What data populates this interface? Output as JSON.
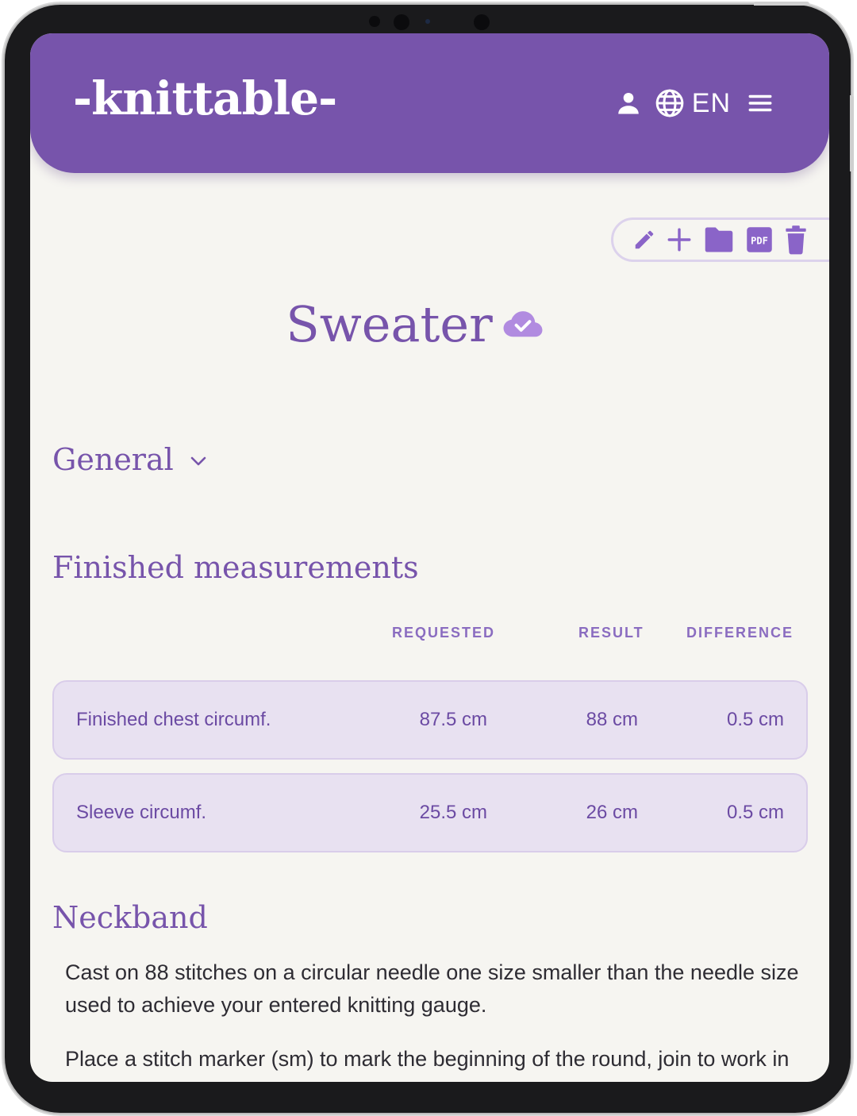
{
  "app": {
    "logo_text": "-knittable-",
    "language_code": "EN"
  },
  "page": {
    "title": "Sweater"
  },
  "sections": {
    "general": "General",
    "finished_measurements": "Finished measurements",
    "neckband": "Neckband"
  },
  "table": {
    "headers": [
      "REQUESTED",
      "RESULT",
      "DIFFERENCE"
    ],
    "rows": [
      {
        "name": "Finished chest circumf.",
        "requested": "87.5 cm",
        "result": "88 cm",
        "difference": "0.5 cm"
      },
      {
        "name": "Sleeve circumf.",
        "requested": "25.5 cm",
        "result": "26 cm",
        "difference": "0.5 cm"
      }
    ]
  },
  "neckband": {
    "paragraphs": [
      "Cast on 88 stitches on a circular needle one size smaller than the needle size used to achieve your entered knitting gauge.",
      "Place a stitch marker (sm) to mark the beginning of the round, join to work in"
    ]
  },
  "toolbar": {
    "pdf_label": "PDF"
  },
  "icons": {
    "user": "user-icon",
    "globe": "globe-icon",
    "menu": "menu-icon",
    "edit": "pencil-icon",
    "add": "plus-icon",
    "folder": "folder-icon",
    "pdf": "pdf-icon",
    "delete": "trash-icon",
    "saved": "cloud-check-icon",
    "expand": "chevron-down-icon"
  },
  "colors": {
    "brand": "#7754ab",
    "background": "#f6f5f1",
    "row_fill": "#e8e1f1",
    "accent_light": "#b18be0"
  }
}
